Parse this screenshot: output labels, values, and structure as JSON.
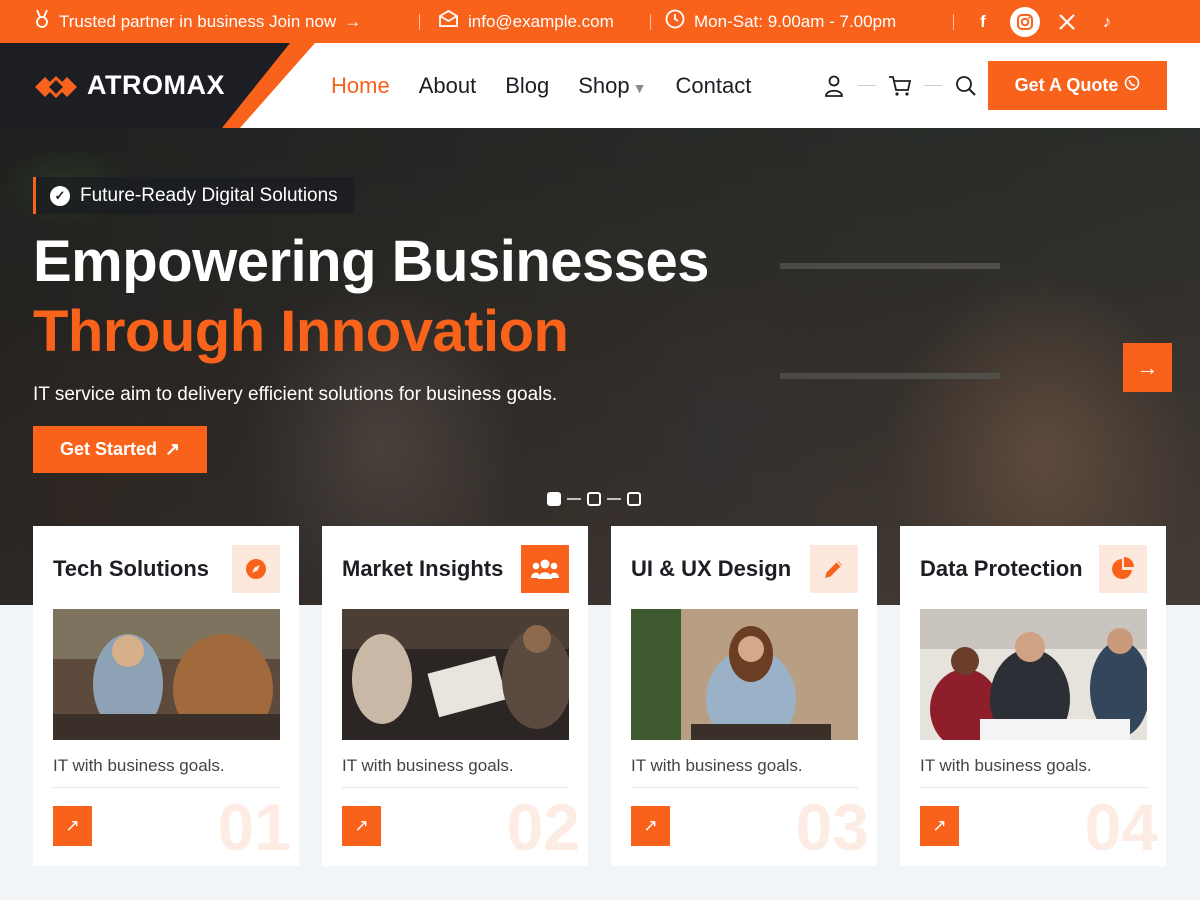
{
  "topbar": {
    "promo": "Trusted partner in business Join now",
    "promo_arrow": "→",
    "email": "info@example.com",
    "hours": "Mon-Sat: 9.00am - 7.00pm",
    "socials": [
      {
        "icon": "facebook-icon",
        "glyph": "f"
      },
      {
        "icon": "instagram-icon",
        "glyph": "◎"
      },
      {
        "icon": "x-icon",
        "glyph": "𝕏"
      },
      {
        "icon": "tiktok-icon",
        "glyph": "♪"
      }
    ]
  },
  "header": {
    "logo": "ATROMAX",
    "nav": [
      "Home",
      "About",
      "Blog",
      "Shop",
      "Contact"
    ],
    "active_nav": "Home",
    "shop_caret": "▼",
    "quote_label": "Get A Quote",
    "quote_icon": "☏"
  },
  "hero": {
    "badge": "Future-Ready Digital Solutions",
    "badge_icon": "✓",
    "title_line1": "Empowering Businesses",
    "title_line2": "Through Innovation",
    "subtitle": "IT service aim to delivery efficient solutions for business goals.",
    "cta_label": "Get Started",
    "cta_icon": "↗",
    "next_icon": "→",
    "slides": 3,
    "active_slide": 1
  },
  "cards": [
    {
      "title": "Tech Solutions",
      "icon": "compass-icon",
      "desc": "IT with business goals.",
      "num": "01",
      "arrow": "↗"
    },
    {
      "title": "Market Insights",
      "icon": "users-icon",
      "desc": "IT with business goals.",
      "num": "02",
      "arrow": "↗"
    },
    {
      "title": "UI & UX Design",
      "icon": "pencil-icon",
      "desc": "IT with business goals.",
      "num": "03",
      "arrow": "↗"
    },
    {
      "title": "Data Protection",
      "icon": "pie-chart-icon",
      "desc": "IT with business goals.",
      "num": "04",
      "arrow": "↗"
    }
  ],
  "colors": {
    "accent": "#f9621b",
    "dark": "#1d1e24",
    "page_bg": "#f2f5f8"
  }
}
